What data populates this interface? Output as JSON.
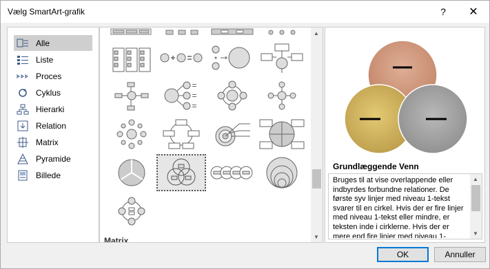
{
  "window": {
    "title": "Vælg SmartArt-grafik",
    "help_glyph": "?",
    "close_glyph": "✕"
  },
  "categories": [
    {
      "label": "Alle",
      "icon": "all-icon",
      "selected": true
    },
    {
      "label": "Liste",
      "icon": "list-icon"
    },
    {
      "label": "Proces",
      "icon": "process-icon"
    },
    {
      "label": "Cyklus",
      "icon": "cycle-icon"
    },
    {
      "label": "Hierarki",
      "icon": "hierarchy-icon"
    },
    {
      "label": "Relation",
      "icon": "relation-icon"
    },
    {
      "label": "Matrix",
      "icon": "matrix-icon"
    },
    {
      "label": "Pyramide",
      "icon": "pyramid-icon"
    },
    {
      "label": "Billede",
      "icon": "picture-icon"
    }
  ],
  "gallery": {
    "section_label": "Matrix",
    "selected_item": "Grundlæggende Venn"
  },
  "preview": {
    "title": "Grundlæggende Venn",
    "description": "Bruges til at vise overlappende eller indbyrdes forbundne relationer. De første syv linjer med niveau 1-tekst svarer til en cirkel. Hvis der er fire linjer med niveau 1-tekst eller mindre, er teksten inde i cirklerne. Hvis der er mere end fire linjer med niveau 1-",
    "colors": {
      "top": "#c8876a",
      "left": "#c9a84a",
      "right": "#9b9b9b"
    }
  },
  "buttons": {
    "ok": "OK",
    "cancel": "Annuller"
  }
}
